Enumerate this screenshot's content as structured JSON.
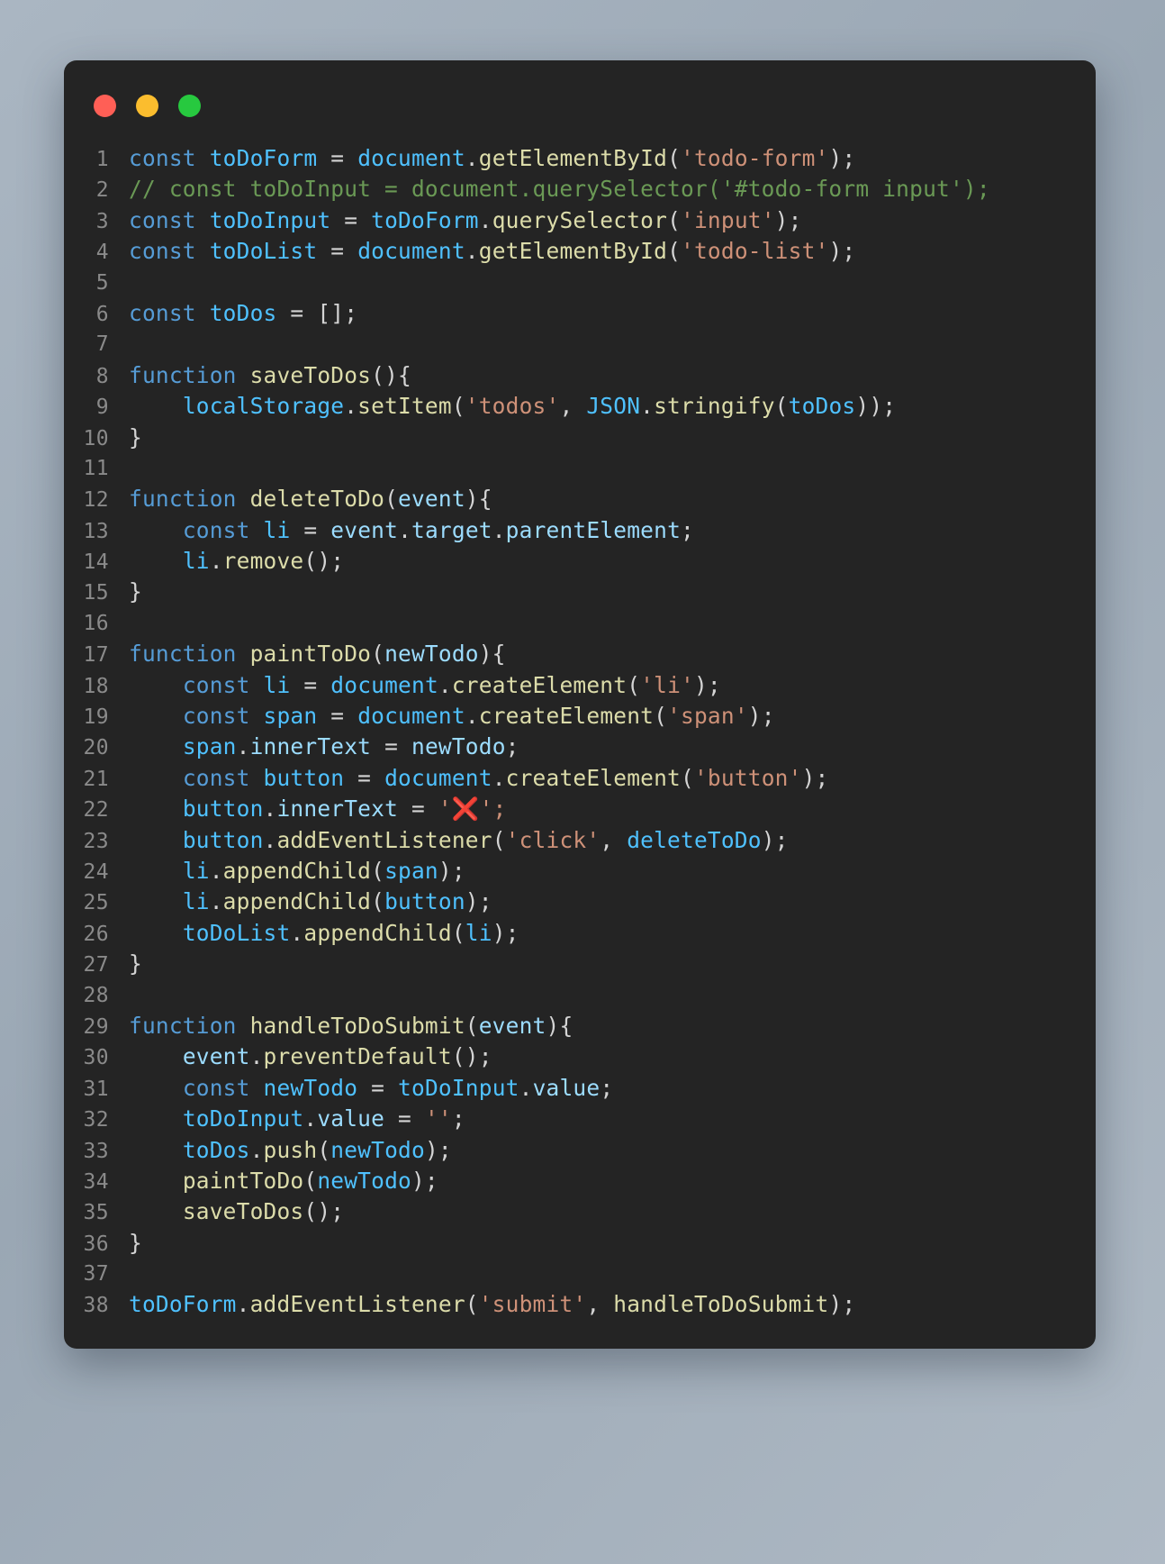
{
  "window": {
    "title": "",
    "traffic_lights": [
      {
        "name": "close",
        "color": "#ff5f56"
      },
      {
        "name": "minimize",
        "color": "#fbbd2e"
      },
      {
        "name": "maximize",
        "color": "#27c93f"
      }
    ],
    "background_color": "#242424",
    "page_background_color": "#a8b4c0"
  },
  "theme": {
    "keyword": "#569cd6",
    "variable": "#4fc1ff",
    "parameter": "#9cdcfe",
    "function": "#dcdcaa",
    "string": "#ce9178",
    "comment": "#6a9955",
    "plain": "#d4d4d4",
    "line_number": "#8a8a8a"
  },
  "editor": {
    "language": "javascript",
    "first_line_number": 1,
    "total_lines": 38,
    "plain_text": "const toDoForm = document.getElementById('todo-form');\n// const toDoInput = document.querySelector('#todo-form input');\nconst toDoInput = toDoForm.querySelector('input');\nconst toDoList = document.getElementById('todo-list');\n\nconst toDos = [];\n\nfunction saveToDos(){\n    localStorage.setItem('todos', JSON.stringify(toDos));\n}\n\nfunction deleteToDo(event){\n    const li = event.target.parentElement;\n    li.remove();\n}\n\nfunction paintToDo(newTodo){\n    const li = document.createElement('li');\n    const span = document.createElement('span');\n    span.innerText = newTodo;\n    const button = document.createElement('button');\n    button.innerText = '❌';\n    button.addEventListener('click', deleteToDo);\n    li.appendChild(span);\n    li.appendChild(button);\n    toDoList.appendChild(li);\n}\n\nfunction handleToDoSubmit(event){\n    event.preventDefault();\n    const newTodo = toDoInput.value;\n    toDoInput.value = '';\n    toDos.push(newTodo);\n    paintToDo(newTodo);\n    saveToDos();\n}\n\ntoDoForm.addEventListener('submit', handleToDoSubmit);",
    "lines": [
      {
        "n": "1",
        "tokens": [
          {
            "t": "const",
            "c": "kw"
          },
          {
            "t": " ",
            "c": "plain"
          },
          {
            "t": "toDoForm",
            "c": "var"
          },
          {
            "t": " = ",
            "c": "plain"
          },
          {
            "t": "document",
            "c": "var"
          },
          {
            "t": ".",
            "c": "punc"
          },
          {
            "t": "getElementById",
            "c": "fn"
          },
          {
            "t": "(",
            "c": "punc"
          },
          {
            "t": "'todo-form'",
            "c": "str"
          },
          {
            "t": ");",
            "c": "punc"
          }
        ]
      },
      {
        "n": "2",
        "tokens": [
          {
            "t": "// const toDoInput = document.querySelector('#todo-form input');",
            "c": "cmt"
          }
        ]
      },
      {
        "n": "3",
        "tokens": [
          {
            "t": "const",
            "c": "kw"
          },
          {
            "t": " ",
            "c": "plain"
          },
          {
            "t": "toDoInput",
            "c": "var"
          },
          {
            "t": " = ",
            "c": "plain"
          },
          {
            "t": "toDoForm",
            "c": "var"
          },
          {
            "t": ".",
            "c": "punc"
          },
          {
            "t": "querySelector",
            "c": "fn"
          },
          {
            "t": "(",
            "c": "punc"
          },
          {
            "t": "'input'",
            "c": "str"
          },
          {
            "t": ");",
            "c": "punc"
          }
        ]
      },
      {
        "n": "4",
        "tokens": [
          {
            "t": "const",
            "c": "kw"
          },
          {
            "t": " ",
            "c": "plain"
          },
          {
            "t": "toDoList",
            "c": "var"
          },
          {
            "t": " = ",
            "c": "plain"
          },
          {
            "t": "document",
            "c": "var"
          },
          {
            "t": ".",
            "c": "punc"
          },
          {
            "t": "getElementById",
            "c": "fn"
          },
          {
            "t": "(",
            "c": "punc"
          },
          {
            "t": "'todo-list'",
            "c": "str"
          },
          {
            "t": ");",
            "c": "punc"
          }
        ]
      },
      {
        "n": "5",
        "tokens": []
      },
      {
        "n": "6",
        "tokens": [
          {
            "t": "const",
            "c": "kw"
          },
          {
            "t": " ",
            "c": "plain"
          },
          {
            "t": "toDos",
            "c": "var"
          },
          {
            "t": " = [];",
            "c": "punc"
          }
        ]
      },
      {
        "n": "7",
        "tokens": []
      },
      {
        "n": "8",
        "tokens": [
          {
            "t": "function",
            "c": "kw"
          },
          {
            "t": " ",
            "c": "plain"
          },
          {
            "t": "saveToDos",
            "c": "fn"
          },
          {
            "t": "(){",
            "c": "punc"
          }
        ]
      },
      {
        "n": "9",
        "tokens": [
          {
            "t": "    ",
            "c": "plain"
          },
          {
            "t": "localStorage",
            "c": "var"
          },
          {
            "t": ".",
            "c": "punc"
          },
          {
            "t": "setItem",
            "c": "fn"
          },
          {
            "t": "(",
            "c": "punc"
          },
          {
            "t": "'todos'",
            "c": "str"
          },
          {
            "t": ", ",
            "c": "punc"
          },
          {
            "t": "JSON",
            "c": "var"
          },
          {
            "t": ".",
            "c": "punc"
          },
          {
            "t": "stringify",
            "c": "fn"
          },
          {
            "t": "(",
            "c": "punc"
          },
          {
            "t": "toDos",
            "c": "var"
          },
          {
            "t": "));",
            "c": "punc"
          }
        ]
      },
      {
        "n": "10",
        "tokens": [
          {
            "t": "}",
            "c": "punc"
          }
        ]
      },
      {
        "n": "11",
        "tokens": []
      },
      {
        "n": "12",
        "tokens": [
          {
            "t": "function",
            "c": "kw"
          },
          {
            "t": " ",
            "c": "plain"
          },
          {
            "t": "deleteToDo",
            "c": "fn"
          },
          {
            "t": "(",
            "c": "punc"
          },
          {
            "t": "event",
            "c": "param"
          },
          {
            "t": "){",
            "c": "punc"
          }
        ]
      },
      {
        "n": "13",
        "tokens": [
          {
            "t": "    ",
            "c": "plain"
          },
          {
            "t": "const",
            "c": "kw"
          },
          {
            "t": " ",
            "c": "plain"
          },
          {
            "t": "li",
            "c": "var"
          },
          {
            "t": " = ",
            "c": "plain"
          },
          {
            "t": "event",
            "c": "param"
          },
          {
            "t": ".",
            "c": "punc"
          },
          {
            "t": "target",
            "c": "param"
          },
          {
            "t": ".",
            "c": "punc"
          },
          {
            "t": "parentElement",
            "c": "param"
          },
          {
            "t": ";",
            "c": "punc"
          }
        ]
      },
      {
        "n": "14",
        "tokens": [
          {
            "t": "    ",
            "c": "plain"
          },
          {
            "t": "li",
            "c": "var"
          },
          {
            "t": ".",
            "c": "punc"
          },
          {
            "t": "remove",
            "c": "fn"
          },
          {
            "t": "();",
            "c": "punc"
          }
        ]
      },
      {
        "n": "15",
        "tokens": [
          {
            "t": "}",
            "c": "punc"
          }
        ]
      },
      {
        "n": "16",
        "tokens": []
      },
      {
        "n": "17",
        "tokens": [
          {
            "t": "function",
            "c": "kw"
          },
          {
            "t": " ",
            "c": "plain"
          },
          {
            "t": "paintToDo",
            "c": "fn"
          },
          {
            "t": "(",
            "c": "punc"
          },
          {
            "t": "newTodo",
            "c": "param"
          },
          {
            "t": "){",
            "c": "punc"
          }
        ]
      },
      {
        "n": "18",
        "tokens": [
          {
            "t": "    ",
            "c": "plain"
          },
          {
            "t": "const",
            "c": "kw"
          },
          {
            "t": " ",
            "c": "plain"
          },
          {
            "t": "li",
            "c": "var"
          },
          {
            "t": " = ",
            "c": "plain"
          },
          {
            "t": "document",
            "c": "var"
          },
          {
            "t": ".",
            "c": "punc"
          },
          {
            "t": "createElement",
            "c": "fn"
          },
          {
            "t": "(",
            "c": "punc"
          },
          {
            "t": "'li'",
            "c": "str"
          },
          {
            "t": ");",
            "c": "punc"
          }
        ]
      },
      {
        "n": "19",
        "tokens": [
          {
            "t": "    ",
            "c": "plain"
          },
          {
            "t": "const",
            "c": "kw"
          },
          {
            "t": " ",
            "c": "plain"
          },
          {
            "t": "span",
            "c": "var"
          },
          {
            "t": " = ",
            "c": "plain"
          },
          {
            "t": "document",
            "c": "var"
          },
          {
            "t": ".",
            "c": "punc"
          },
          {
            "t": "createElement",
            "c": "fn"
          },
          {
            "t": "(",
            "c": "punc"
          },
          {
            "t": "'span'",
            "c": "str"
          },
          {
            "t": ");",
            "c": "punc"
          }
        ]
      },
      {
        "n": "20",
        "tokens": [
          {
            "t": "    ",
            "c": "plain"
          },
          {
            "t": "span",
            "c": "var"
          },
          {
            "t": ".",
            "c": "punc"
          },
          {
            "t": "innerText",
            "c": "param"
          },
          {
            "t": " = ",
            "c": "plain"
          },
          {
            "t": "newTodo",
            "c": "param"
          },
          {
            "t": ";",
            "c": "punc"
          }
        ]
      },
      {
        "n": "21",
        "tokens": [
          {
            "t": "    ",
            "c": "plain"
          },
          {
            "t": "const",
            "c": "kw"
          },
          {
            "t": " ",
            "c": "plain"
          },
          {
            "t": "button",
            "c": "var"
          },
          {
            "t": " = ",
            "c": "plain"
          },
          {
            "t": "document",
            "c": "var"
          },
          {
            "t": ".",
            "c": "punc"
          },
          {
            "t": "createElement",
            "c": "fn"
          },
          {
            "t": "(",
            "c": "punc"
          },
          {
            "t": "'button'",
            "c": "str"
          },
          {
            "t": ");",
            "c": "punc"
          }
        ]
      },
      {
        "n": "22",
        "tokens": [
          {
            "t": "    ",
            "c": "plain"
          },
          {
            "t": "button",
            "c": "var"
          },
          {
            "t": ".",
            "c": "punc"
          },
          {
            "t": "innerText",
            "c": "param"
          },
          {
            "t": " = ",
            "c": "plain"
          },
          {
            "t": "'",
            "c": "str"
          },
          {
            "t": "❌",
            "c": "emoji"
          },
          {
            "t": "';",
            "c": "str"
          }
        ]
      },
      {
        "n": "23",
        "tokens": [
          {
            "t": "    ",
            "c": "plain"
          },
          {
            "t": "button",
            "c": "var"
          },
          {
            "t": ".",
            "c": "punc"
          },
          {
            "t": "addEventListener",
            "c": "fn"
          },
          {
            "t": "(",
            "c": "punc"
          },
          {
            "t": "'click'",
            "c": "str"
          },
          {
            "t": ", ",
            "c": "punc"
          },
          {
            "t": "deleteToDo",
            "c": "var"
          },
          {
            "t": ");",
            "c": "punc"
          }
        ]
      },
      {
        "n": "24",
        "tokens": [
          {
            "t": "    ",
            "c": "plain"
          },
          {
            "t": "li",
            "c": "var"
          },
          {
            "t": ".",
            "c": "punc"
          },
          {
            "t": "appendChild",
            "c": "fn"
          },
          {
            "t": "(",
            "c": "punc"
          },
          {
            "t": "span",
            "c": "var"
          },
          {
            "t": ");",
            "c": "punc"
          }
        ]
      },
      {
        "n": "25",
        "tokens": [
          {
            "t": "    ",
            "c": "plain"
          },
          {
            "t": "li",
            "c": "var"
          },
          {
            "t": ".",
            "c": "punc"
          },
          {
            "t": "appendChild",
            "c": "fn"
          },
          {
            "t": "(",
            "c": "punc"
          },
          {
            "t": "button",
            "c": "var"
          },
          {
            "t": ");",
            "c": "punc"
          }
        ]
      },
      {
        "n": "26",
        "tokens": [
          {
            "t": "    ",
            "c": "plain"
          },
          {
            "t": "toDoList",
            "c": "var"
          },
          {
            "t": ".",
            "c": "punc"
          },
          {
            "t": "appendChild",
            "c": "fn"
          },
          {
            "t": "(",
            "c": "punc"
          },
          {
            "t": "li",
            "c": "var"
          },
          {
            "t": ");",
            "c": "punc"
          }
        ]
      },
      {
        "n": "27",
        "tokens": [
          {
            "t": "}",
            "c": "punc"
          }
        ]
      },
      {
        "n": "28",
        "tokens": []
      },
      {
        "n": "29",
        "tokens": [
          {
            "t": "function",
            "c": "kw"
          },
          {
            "t": " ",
            "c": "plain"
          },
          {
            "t": "handleToDoSubmit",
            "c": "fn"
          },
          {
            "t": "(",
            "c": "punc"
          },
          {
            "t": "event",
            "c": "param"
          },
          {
            "t": "){",
            "c": "punc"
          }
        ]
      },
      {
        "n": "30",
        "tokens": [
          {
            "t": "    ",
            "c": "plain"
          },
          {
            "t": "event",
            "c": "param"
          },
          {
            "t": ".",
            "c": "punc"
          },
          {
            "t": "preventDefault",
            "c": "fn"
          },
          {
            "t": "();",
            "c": "punc"
          }
        ]
      },
      {
        "n": "31",
        "tokens": [
          {
            "t": "    ",
            "c": "plain"
          },
          {
            "t": "const",
            "c": "kw"
          },
          {
            "t": " ",
            "c": "plain"
          },
          {
            "t": "newTodo",
            "c": "var"
          },
          {
            "t": " = ",
            "c": "plain"
          },
          {
            "t": "toDoInput",
            "c": "var"
          },
          {
            "t": ".",
            "c": "punc"
          },
          {
            "t": "value",
            "c": "param"
          },
          {
            "t": ";",
            "c": "punc"
          }
        ]
      },
      {
        "n": "32",
        "tokens": [
          {
            "t": "    ",
            "c": "plain"
          },
          {
            "t": "toDoInput",
            "c": "var"
          },
          {
            "t": ".",
            "c": "punc"
          },
          {
            "t": "value",
            "c": "param"
          },
          {
            "t": " = ",
            "c": "plain"
          },
          {
            "t": "''",
            "c": "str"
          },
          {
            "t": ";",
            "c": "punc"
          }
        ]
      },
      {
        "n": "33",
        "tokens": [
          {
            "t": "    ",
            "c": "plain"
          },
          {
            "t": "toDos",
            "c": "var"
          },
          {
            "t": ".",
            "c": "punc"
          },
          {
            "t": "push",
            "c": "fn"
          },
          {
            "t": "(",
            "c": "punc"
          },
          {
            "t": "newTodo",
            "c": "var"
          },
          {
            "t": ");",
            "c": "punc"
          }
        ]
      },
      {
        "n": "34",
        "tokens": [
          {
            "t": "    ",
            "c": "plain"
          },
          {
            "t": "paintToDo",
            "c": "fn"
          },
          {
            "t": "(",
            "c": "punc"
          },
          {
            "t": "newTodo",
            "c": "var"
          },
          {
            "t": ");",
            "c": "punc"
          }
        ]
      },
      {
        "n": "35",
        "tokens": [
          {
            "t": "    ",
            "c": "plain"
          },
          {
            "t": "saveToDos",
            "c": "fn"
          },
          {
            "t": "();",
            "c": "punc"
          }
        ]
      },
      {
        "n": "36",
        "tokens": [
          {
            "t": "}",
            "c": "punc"
          }
        ]
      },
      {
        "n": "37",
        "tokens": []
      },
      {
        "n": "38",
        "tokens": [
          {
            "t": "toDoForm",
            "c": "var"
          },
          {
            "t": ".",
            "c": "punc"
          },
          {
            "t": "addEventListener",
            "c": "fn"
          },
          {
            "t": "(",
            "c": "punc"
          },
          {
            "t": "'submit'",
            "c": "str"
          },
          {
            "t": ", ",
            "c": "punc"
          },
          {
            "t": "handleToDoSubmit",
            "c": "fn"
          },
          {
            "t": ");",
            "c": "punc"
          }
        ]
      }
    ]
  }
}
